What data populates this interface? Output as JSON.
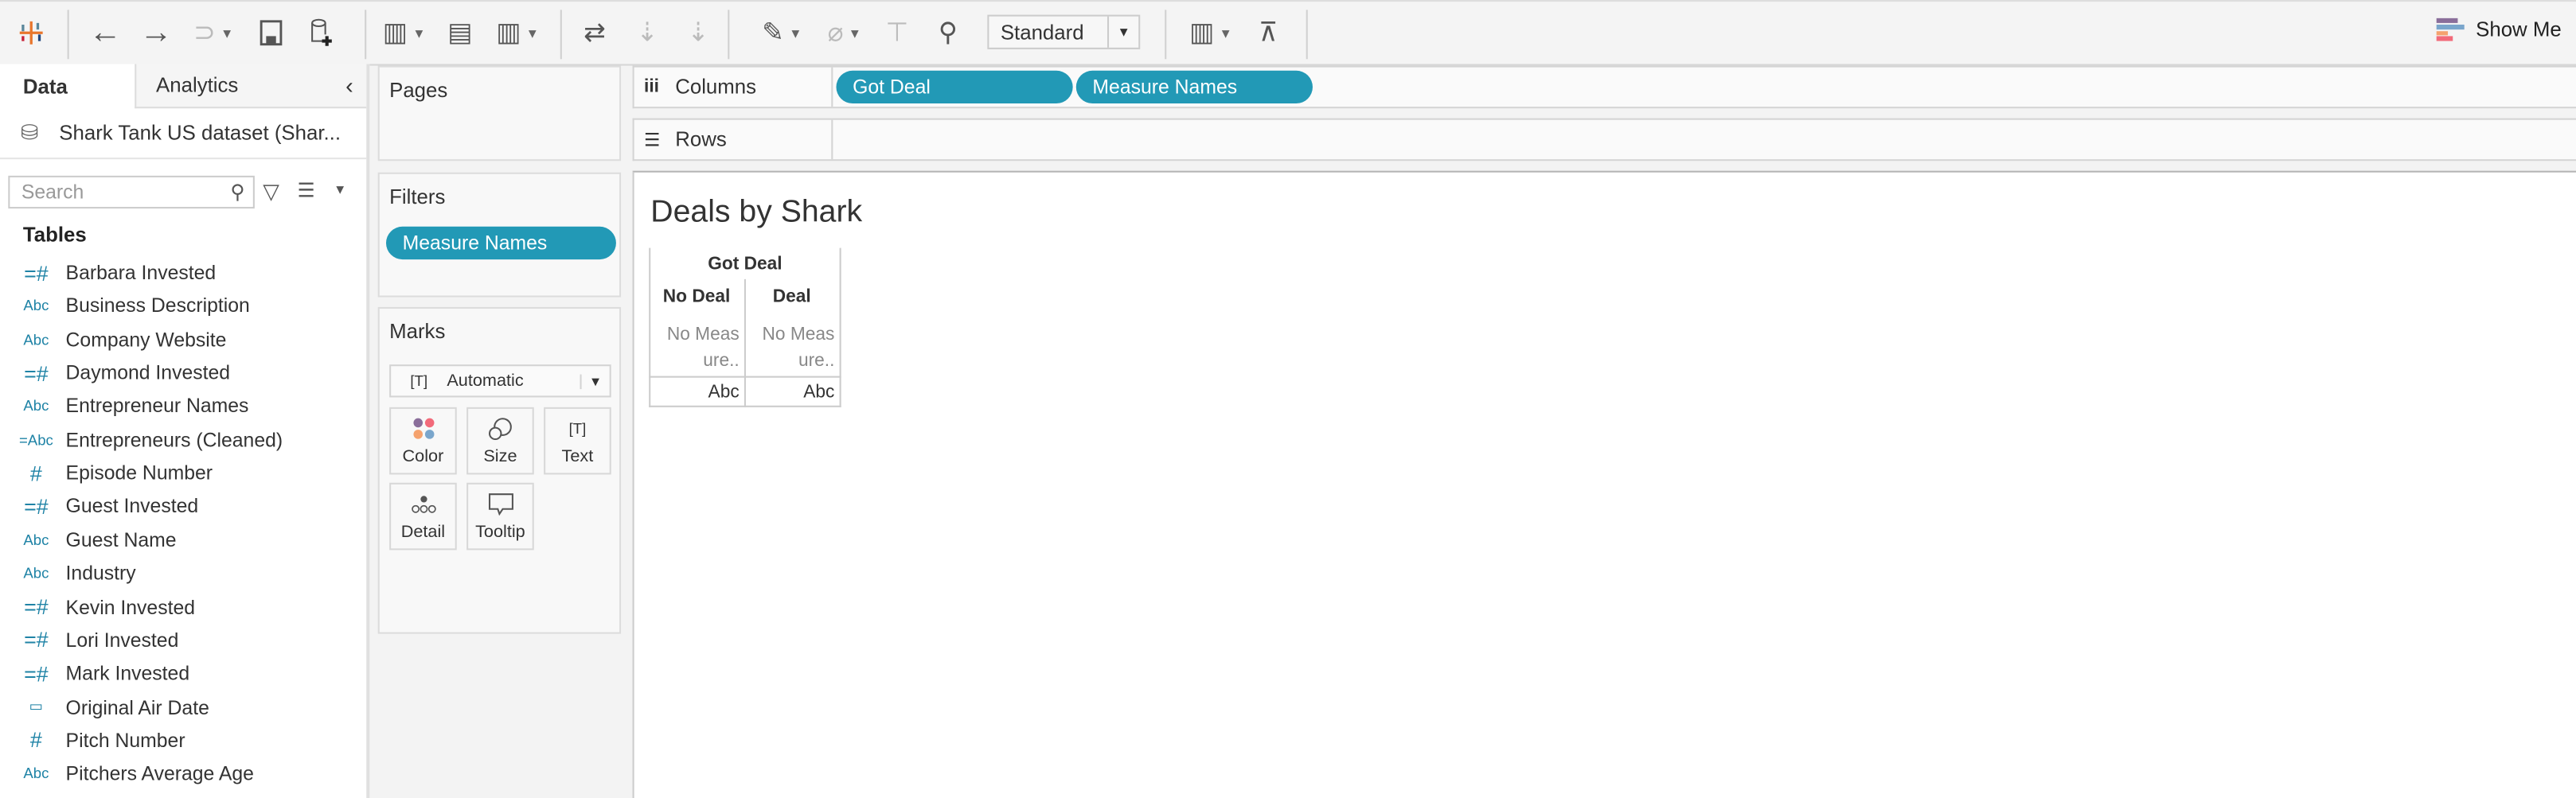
{
  "toolbar": {
    "mark_type_select": "Standard",
    "show_me": "Show Me",
    "show_me_colors": [
      "#8a6e9a",
      "#7aa6cc",
      "#f5a26e",
      "#f26a7a"
    ]
  },
  "left_panel": {
    "tabs": [
      {
        "label": "Data",
        "active": true
      },
      {
        "label": "Analytics",
        "active": false
      }
    ],
    "datasource": "Shark Tank US dataset (Shar...",
    "search_placeholder": "Search",
    "tables_heading": "Tables",
    "fields": [
      {
        "label": "Barbara Invested",
        "type": "=#"
      },
      {
        "label": "Business Description",
        "type": "Abc"
      },
      {
        "label": "Company Website",
        "type": "Abc"
      },
      {
        "label": "Daymond Invested",
        "type": "=#"
      },
      {
        "label": "Entrepreneur Names",
        "type": "Abc"
      },
      {
        "label": "Entrepreneurs (Cleaned)",
        "type": "=Abc"
      },
      {
        "label": "Episode Number",
        "type": "#"
      },
      {
        "label": "Guest Invested",
        "type": "=#"
      },
      {
        "label": "Guest Name",
        "type": "Abc"
      },
      {
        "label": "Industry",
        "type": "Abc"
      },
      {
        "label": "Kevin Invested",
        "type": "=#"
      },
      {
        "label": "Lori Invested",
        "type": "=#"
      },
      {
        "label": "Mark Invested",
        "type": "=#"
      },
      {
        "label": "Original Air Date",
        "type": "date"
      },
      {
        "label": "Pitch Number",
        "type": "#"
      },
      {
        "label": "Pitchers Average Age",
        "type": "Abc"
      }
    ]
  },
  "cards": {
    "pages": "Pages",
    "filters": "Filters",
    "filter_pills": [
      "Measure Names"
    ],
    "marks": "Marks",
    "mark_type": "Automatic",
    "mark_buttons": [
      "Color",
      "Size",
      "Text",
      "Detail",
      "Tooltip"
    ]
  },
  "shelves": {
    "columns_label": "Columns",
    "columns_pills": [
      "Got Deal",
      "Measure Names"
    ],
    "rows_label": "Rows"
  },
  "view": {
    "title": "Deals by Shark",
    "header": "Got Deal",
    "columns": [
      "No Deal",
      "Deal"
    ],
    "cell_line1": "No Meas",
    "cell_line2": "ure..",
    "footer": "Abc"
  },
  "accent": "#2299b6"
}
